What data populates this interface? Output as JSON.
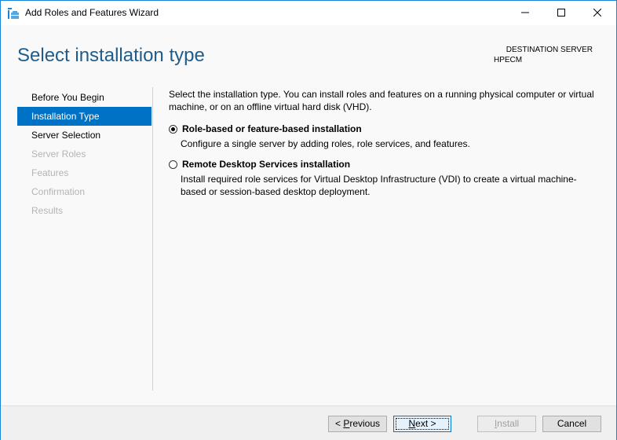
{
  "window": {
    "title": "Add Roles and Features Wizard",
    "controls": {
      "minimize": "minimize",
      "maximize": "maximize",
      "close": "close"
    }
  },
  "header": {
    "page_title": "Select installation type",
    "destination_label": "DESTINATION SERVER",
    "destination_server": "HPECM"
  },
  "nav": {
    "items": [
      {
        "label": "Before You Begin",
        "state": "done"
      },
      {
        "label": "Installation Type",
        "state": "active"
      },
      {
        "label": "Server Selection",
        "state": "done"
      },
      {
        "label": "Server Roles",
        "state": "disabled"
      },
      {
        "label": "Features",
        "state": "disabled"
      },
      {
        "label": "Confirmation",
        "state": "disabled"
      },
      {
        "label": "Results",
        "state": "disabled"
      }
    ]
  },
  "content": {
    "intro": "Select the installation type. You can install roles and features on a running physical computer or virtual machine, or on an offline virtual hard disk (VHD).",
    "options": [
      {
        "label": "Role-based or feature-based installation",
        "description": "Configure a single server by adding roles, role services, and features.",
        "selected": true
      },
      {
        "label": "Remote Desktop Services installation",
        "description": "Install required role services for Virtual Desktop Infrastructure (VDI) to create a virtual machine-based or session-based desktop deployment.",
        "selected": false
      }
    ]
  },
  "footer": {
    "previous": {
      "prefix": "< ",
      "mnemonic": "P",
      "rest": "revious"
    },
    "next": {
      "mnemonic": "N",
      "rest": "ext >"
    },
    "install": {
      "mnemonic": "I",
      "rest": "nstall"
    },
    "cancel": "Cancel"
  },
  "colors": {
    "accent": "#0072c6",
    "title": "#1e5c8c",
    "border": "#1883d7"
  }
}
